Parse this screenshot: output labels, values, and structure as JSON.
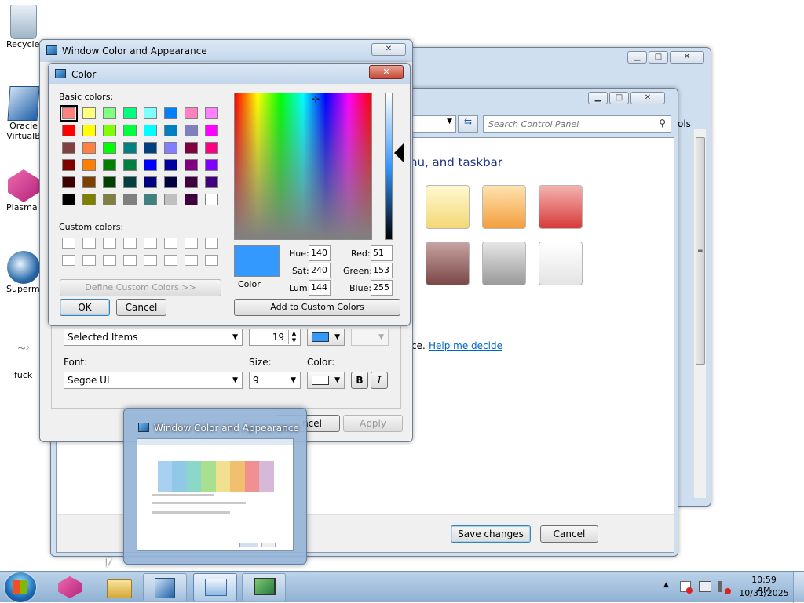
{
  "desktop": {
    "icons": [
      {
        "label": "Recycle"
      },
      {
        "label": "Oracle VirtualB"
      },
      {
        "label": "Plasma"
      },
      {
        "label": "Supermi"
      },
      {
        "label": "fuck"
      }
    ]
  },
  "back_window": {
    "search_placeholder": "Search Control Panel",
    "heading": "nu, and taskbar",
    "help_prefix": "ce.",
    "help_link": "Help me decide",
    "save_label": "Save changes",
    "cancel_label": "Cancel",
    "cut_text": "ols",
    "tile_colors": [
      "#f9e68f",
      "#f7b75a",
      "#e05b5b",
      "#8a5b5a",
      "#b5b5b5",
      "#f2f2f2"
    ]
  },
  "appearance": {
    "title": "Window Color and Appearance",
    "item_value": "Selected Items",
    "size_value": "19",
    "font_label": "Font:",
    "font_value": "Segoe UI",
    "size_label": "Size:",
    "font_size_value": "9",
    "color_label": "Color:",
    "bold_label": "B",
    "italic_label": "I",
    "cancel_partial": "ncel",
    "apply_label": "Apply",
    "item_color": "#3399ff"
  },
  "color_dialog": {
    "title": "Color",
    "basic_label": "Basic colors:",
    "custom_label": "Custom colors:",
    "define_label": "Define Custom Colors >>",
    "ok_label": "OK",
    "cancel_label": "Cancel",
    "add_label": "Add to Custom Colors",
    "color_caption": "Color",
    "hue_label": "Hue:",
    "hue": "140",
    "sat_label": "Sat:",
    "sat": "240",
    "lum_label": "Lum:",
    "lum": "144",
    "red_label": "Red:",
    "red": "51",
    "green_label": "Green:",
    "green": "153",
    "blue_label": "Blue:",
    "blue": "255",
    "preview_color": "#3399ff",
    "basic_colors": [
      "#ff8080",
      "#ffff80",
      "#80ff80",
      "#00ff80",
      "#80ffff",
      "#0080ff",
      "#ff80c0",
      "#ff80ff",
      "#ff0000",
      "#ffff00",
      "#80ff00",
      "#00ff40",
      "#00ffff",
      "#0080c0",
      "#8080c0",
      "#ff00ff",
      "#804040",
      "#ff8040",
      "#00ff00",
      "#008080",
      "#004080",
      "#8080ff",
      "#800040",
      "#ff0080",
      "#800000",
      "#ff8000",
      "#008000",
      "#008040",
      "#0000ff",
      "#0000a0",
      "#800080",
      "#8000ff",
      "#400000",
      "#804000",
      "#004000",
      "#004040",
      "#000080",
      "#000040",
      "#400040",
      "#400080",
      "#000000",
      "#808000",
      "#808040",
      "#808080",
      "#408080",
      "#c0c0c0",
      "#400040",
      "#ffffff"
    ]
  },
  "thumbnail": {
    "title": "Window Color and Appearance"
  },
  "taskbar": {
    "time": "10:59 AM",
    "date": "10/31/2025"
  }
}
